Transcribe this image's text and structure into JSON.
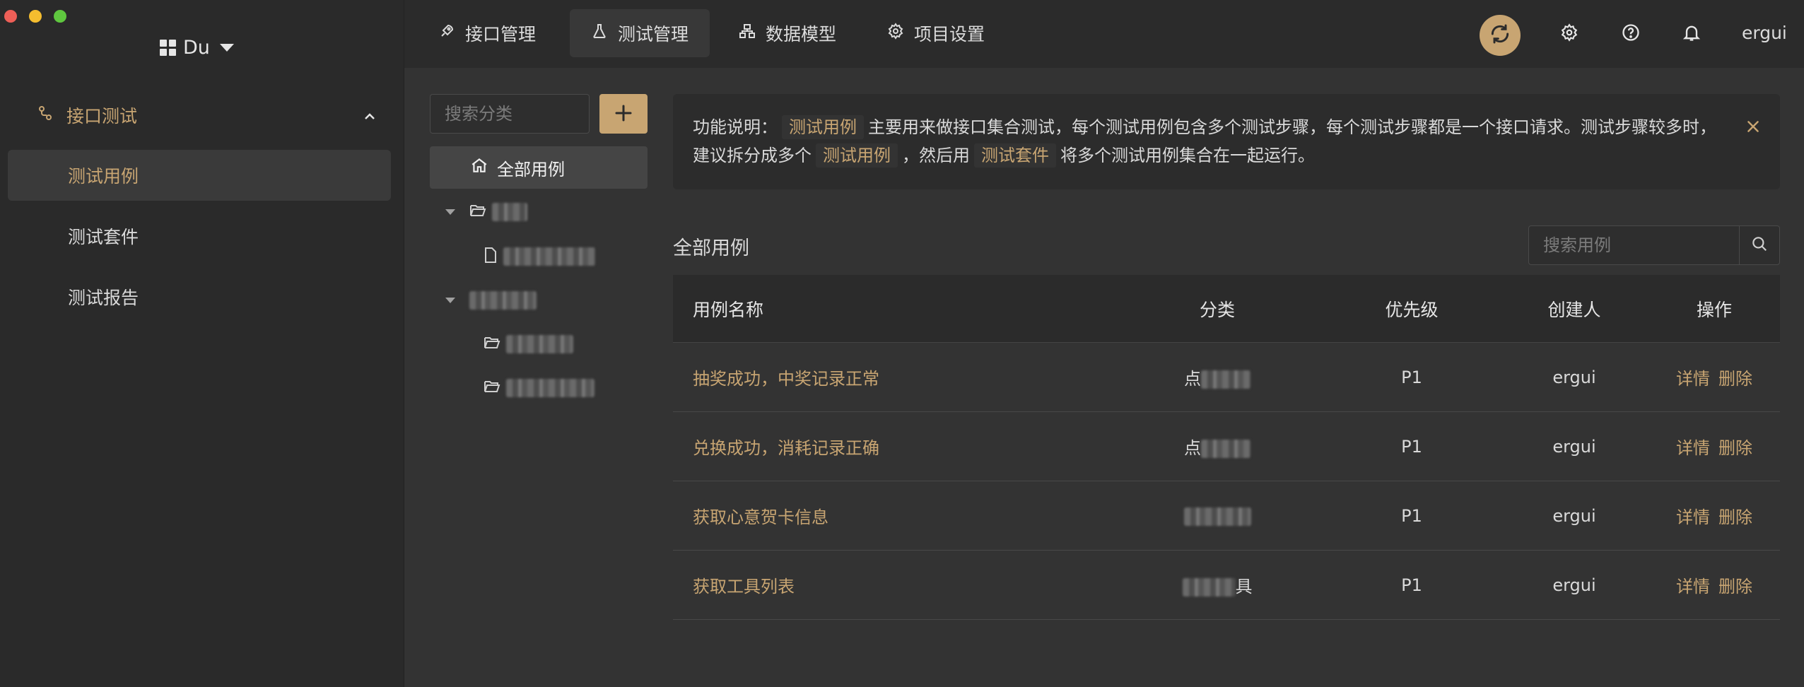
{
  "workspace": {
    "name": "Du"
  },
  "sidebar": {
    "group_label": "接口测试",
    "items": [
      {
        "label": "测试用例",
        "active": true
      },
      {
        "label": "测试套件",
        "active": false
      },
      {
        "label": "测试报告",
        "active": false
      }
    ]
  },
  "tabs": [
    {
      "label": "接口管理",
      "icon": "rocket-icon"
    },
    {
      "label": "测试管理",
      "icon": "flask-icon",
      "active": true
    },
    {
      "label": "数据模型",
      "icon": "hierarchy-icon"
    },
    {
      "label": "项目设置",
      "icon": "gear-icon"
    }
  ],
  "user": {
    "name": "ergui"
  },
  "categories": {
    "search_placeholder": "搜索分类",
    "all_label": "全部用例"
  },
  "notice": {
    "prefix": "功能说明：",
    "term1": "测试用例",
    "text1": "主要用来做接口集合测试，每个测试用例包含多个测试步骤，每个测试步骤都是一个接口请求。测试步骤较多时，建议拆分成多个",
    "term2": "测试用例",
    "text2": "，然后用",
    "term3": "测试套件",
    "text3": "将多个测试用例集合在一起运行。"
  },
  "section_title": "全部用例",
  "case_search_placeholder": "搜索用例",
  "table": {
    "headers": [
      "用例名称",
      "分类",
      "优先级",
      "创建人",
      "操作"
    ],
    "rows": [
      {
        "name": "抽奖成功，中奖记录正常",
        "category_visible": "点",
        "priority": "P1",
        "creator": "ergui"
      },
      {
        "name": "兑换成功，消耗记录正确",
        "category_visible": "点",
        "priority": "P1",
        "creator": "ergui"
      },
      {
        "name": "获取心意贺卡信息",
        "category_visible": "",
        "priority": "P1",
        "creator": "ergui"
      },
      {
        "name": "获取工具列表",
        "category_visible": "具",
        "priority": "P1",
        "creator": "ergui"
      }
    ],
    "action_detail": "详情",
    "action_delete": "删除"
  },
  "colors": {
    "accent": "#c8a572",
    "sidebar_bg": "#2a2a2a",
    "content_bg": "#333333"
  }
}
